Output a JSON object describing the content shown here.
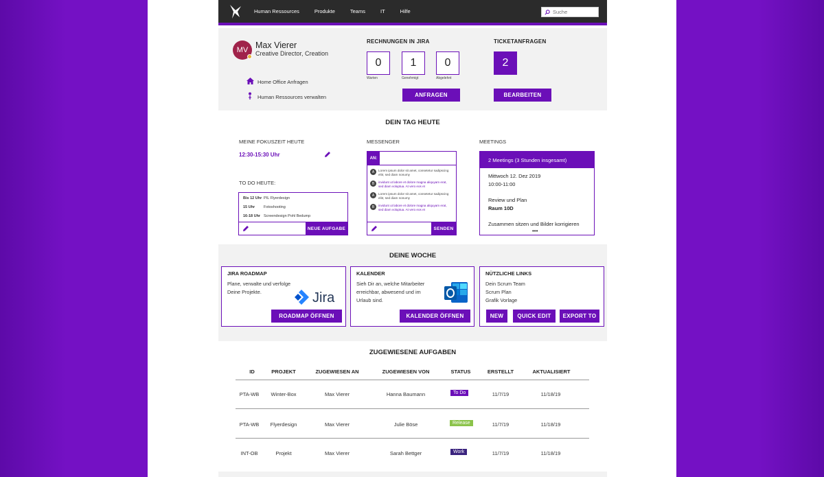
{
  "nav": {
    "links": [
      "Human Ressources",
      "Produkte",
      "Teams",
      "IT",
      "Hilfe"
    ],
    "search_placeholder": "Suche"
  },
  "profile": {
    "initials": "MV",
    "name": "Max Vierer",
    "role": "Creative Director, Creation",
    "links": [
      {
        "icon": "home-icon",
        "label": "Home Office Anfragen"
      },
      {
        "icon": "person-icon",
        "label": "Human Ressources verwalten"
      }
    ]
  },
  "jira": {
    "title": "RECHNUNGEN IN JIRA",
    "counters": [
      {
        "value": "0",
        "label": "Warten"
      },
      {
        "value": "1",
        "label": "Genehmigt"
      },
      {
        "value": "0",
        "label": "Abgelehnt"
      }
    ],
    "button": "ANFRAGEN"
  },
  "tickets": {
    "title": "TICKETANFRAGEN",
    "value": "2",
    "button": "BEARBEITEN"
  },
  "day": {
    "title": "DEIN TAG HEUTE",
    "focus_label": "MEINE FOKUSZEIT HEUTE",
    "focus_time": "12:30-15:30 Uhr",
    "todo_label": "TO DO HEUTE:",
    "todos": [
      {
        "time": "Bis 12 Uhr",
        "task": "PIL Flyerdesign"
      },
      {
        "time": "15 Uhr",
        "task": "Fotoshooting"
      },
      {
        "time": "16-18 Uhr",
        "task": "Screendesign Pohl Bedump"
      }
    ],
    "todo_button": "NEUE AUFGABE",
    "messenger_label": "MESSENGER",
    "messenger_to": "AN:",
    "messages": [
      {
        "from": "A",
        "text": "Lorem ipsum dolor sit amet, consetetur sadipscing elitr, sed diam nonumy"
      },
      {
        "from": "B",
        "text": "invidunt ut labore et dolore magna aliquyam erat, sed diam voluptua. At vero eos et"
      },
      {
        "from": "A",
        "text": "Lorem ipsum dolor sit amet, consetetur sadipscing elitr, sed diam nonumy"
      },
      {
        "from": "B",
        "text": "invidunt ut labore et dolore magna aliquyam erat, sed diam voluptua. At vero eos et"
      }
    ],
    "send_button": "SENDEN",
    "meetings_label": "MEETINGS",
    "meetings_header": "2 Meetings (3 Stunden insgesamt)",
    "meeting_date": "Mittwoch 12. Dez 2019",
    "meeting_time": "10:00-11:00",
    "meeting_title": "Review und Plan",
    "meeting_room": "Raum 10D",
    "meeting_desc": "Zusammen sitzen und Bilder korrigieren",
    "meeting_more": "•••"
  },
  "week": {
    "title": "DEINE WOCHE",
    "cards": [
      {
        "title": "JIRA ROADMAP",
        "text": [
          "Plane, verwalte und verfolge",
          "Deine Projekte."
        ],
        "logo": "Jira",
        "button": "ROADMAP ÖFFNEN"
      },
      {
        "title": "KALENDER",
        "text": [
          "Sieh Dir an, welche Mitarbeiter",
          "erreichbar, abwesend und im",
          "Urlaub sind."
        ],
        "logo": "outlook-icon",
        "button": "KALENDER ÖFFNEN"
      },
      {
        "title": "NÜTZLICHE LINKS",
        "text": [
          "Dein Scrum Team",
          "Scrum Plan",
          "Grafik Vorlage"
        ],
        "buttons": [
          "NEW",
          "QUICK EDIT",
          "EXPORT TO"
        ]
      }
    ]
  },
  "tasks": {
    "title": "ZUGEWIESENE AUFGABEN",
    "columns": [
      "ID",
      "PROJEKT",
      "ZUGEWIESEN AN",
      "ZUGEWIESEN VON",
      "STATUS",
      "ERSTELLT",
      "AKTUALISIERT"
    ],
    "rows": [
      {
        "id": "PTA-WB",
        "project": "Winter-Box",
        "to": "Max Vierer",
        "from": "Hanna Baumann",
        "status": "To Do",
        "status_color": "#6b0fb8",
        "created": "11/7/19",
        "updated": "11/18/19"
      },
      {
        "id": "PTA-WB",
        "project": "Flyerdesign",
        "to": "Max Vierer",
        "from": "Julie Böse",
        "status": "Release",
        "status_color": "#8bc34a",
        "created": "11/7/19",
        "updated": "11/18/19"
      },
      {
        "id": "INT-OB",
        "project": "Projekt",
        "to": "Max Vierer",
        "from": "Sarah Bettger",
        "status": "Work",
        "status_color": "#3a237e",
        "created": "11/7/19",
        "updated": "11/18/19"
      }
    ]
  },
  "colors": {
    "accent": "#6b0fb8",
    "nav_bg": "#2b2b2b",
    "section_bg": "#f2f2f2"
  }
}
